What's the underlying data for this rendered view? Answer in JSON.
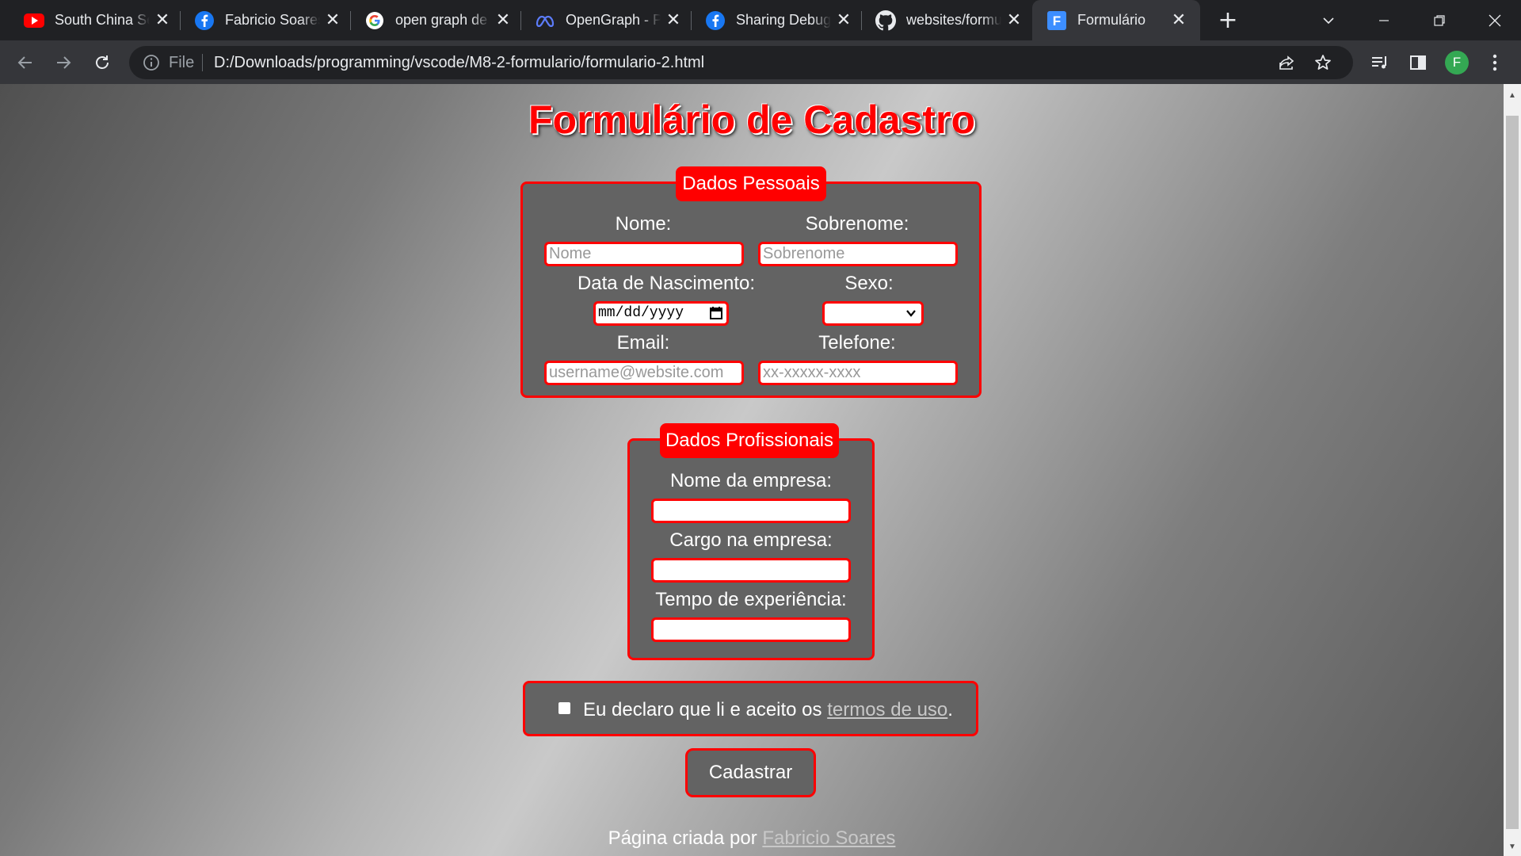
{
  "browser": {
    "tabs": [
      {
        "title": "South China Sea",
        "icon": "youtube-icon"
      },
      {
        "title": "Fabricio Soares",
        "icon": "facebook-icon"
      },
      {
        "title": "open graph de",
        "icon": "google-icon"
      },
      {
        "title": "OpenGraph - P",
        "icon": "meta-icon"
      },
      {
        "title": "Sharing Debugger",
        "icon": "facebook-icon"
      },
      {
        "title": "websites/formulario",
        "icon": "github-icon"
      },
      {
        "title": "Formulário",
        "icon": "site-favicon",
        "favicon_letter": "F",
        "active": true
      }
    ],
    "address": {
      "scheme_label": "File",
      "url": "D:/Downloads/programming/vscode/M8-2-formulario/formulario-2.html"
    },
    "profile_initial": "F"
  },
  "page": {
    "title": "Formulário de Cadastro",
    "personal": {
      "legend": "Dados Pessoais",
      "nome_label": "Nome:",
      "nome_placeholder": "Nome",
      "sobrenome_label": "Sobrenome:",
      "sobrenome_placeholder": "Sobrenome",
      "nascimento_label": "Data de Nascimento:",
      "nascimento_placeholder": "mm/dd/yyyy",
      "sexo_label": "Sexo:",
      "sexo_value": "",
      "email_label": "Email:",
      "email_placeholder": "username@website.com",
      "telefone_label": "Telefone:",
      "telefone_placeholder": "xx-xxxxx-xxxx"
    },
    "professional": {
      "legend": "Dados Profissionais",
      "empresa_label": "Nome da empresa:",
      "empresa_value": "",
      "cargo_label": "Cargo na empresa:",
      "cargo_value": "",
      "experiencia_label": "Tempo de experiência:",
      "experiencia_value": ""
    },
    "terms": {
      "text_before": "Eu declaro que li e aceito os ",
      "link": "termos de uso",
      "text_after": ".",
      "checked": false
    },
    "submit_label": "Cadastrar",
    "footer": {
      "text": "Página criada por ",
      "author_link": "Fabricio Soares"
    }
  },
  "colors": {
    "accent": "#ff0000",
    "panel": "#636363",
    "chrome_dark": "#202124",
    "chrome_toolbar": "#35363a"
  }
}
